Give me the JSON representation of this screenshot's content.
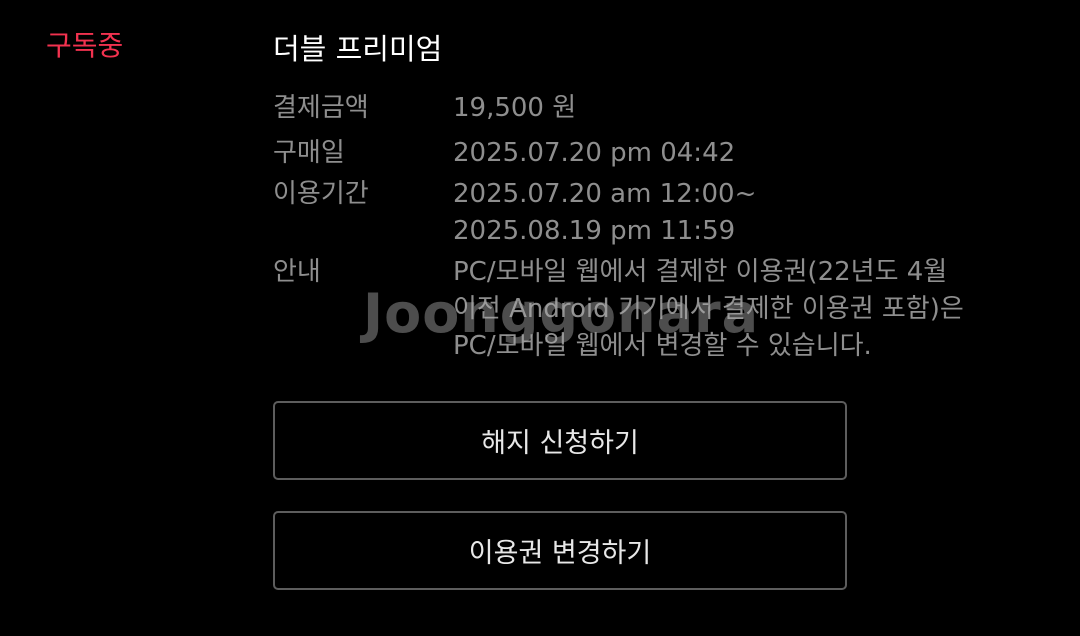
{
  "subscription": {
    "status_label": "구독중",
    "plan_name": "더블 프리미엄",
    "status_color": "#f2324f"
  },
  "details": {
    "price": {
      "label": "결제금액",
      "value": "19,500 원"
    },
    "purchase_date": {
      "label": "구매일",
      "value": "2025.07.20 pm 04:42"
    },
    "period": {
      "label": "이용기간",
      "start": "2025.07.20 am 12:00~",
      "end": "2025.08.19 pm 11:59"
    },
    "notice": {
      "label": "안내",
      "lines": [
        "PC/모바일 웹에서 결제한 이용권(22년도 4월",
        "이전 Android 기기에서 결제한 이용권 포함)은",
        "PC/모바일 웹에서 변경할 수 있습니다."
      ]
    }
  },
  "actions": {
    "cancel_label": "해지 신청하기",
    "change_label": "이용권 변경하기"
  },
  "watermark": {
    "text": "Joonggonara"
  }
}
